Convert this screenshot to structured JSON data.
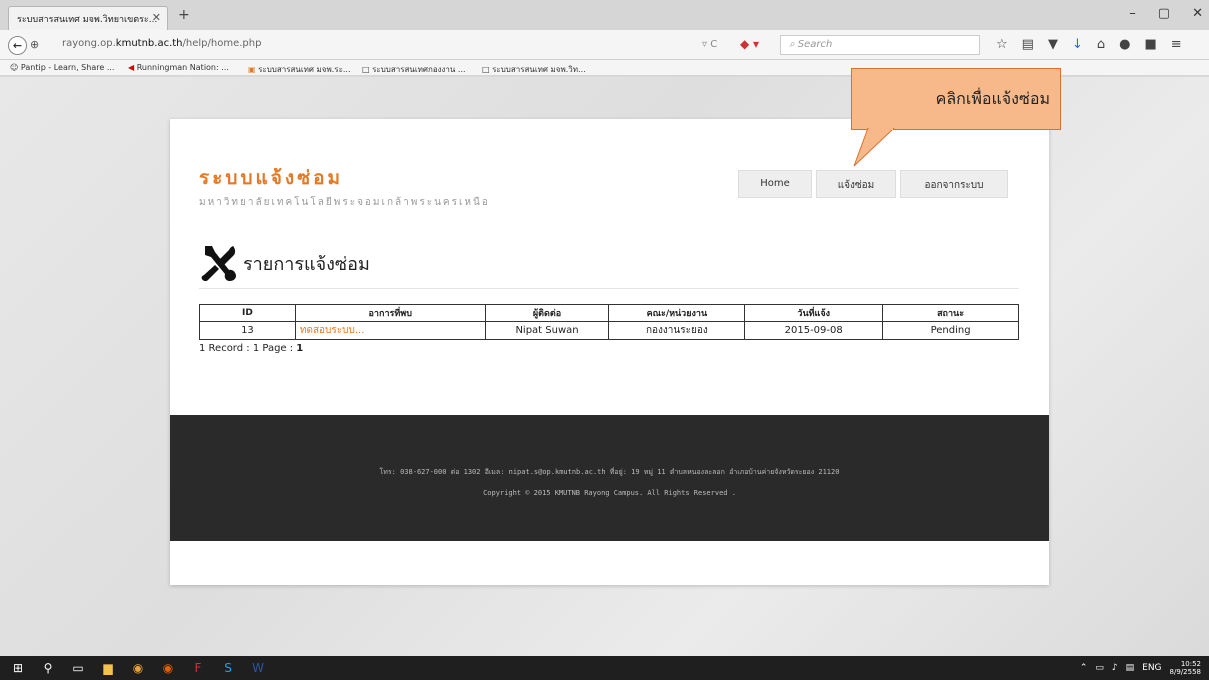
{
  "browser": {
    "tab_title": "ระบบสารสนเทศ มจพ.วิทยาเขตระ...",
    "tab_close": "✕",
    "new_tab": "+",
    "window_controls": [
      "–",
      "▢",
      "✕"
    ],
    "url_prefix": "rayong.op.",
    "url_domain": "kmutnb.ac.th",
    "url_path": "/help/home.php",
    "url_right": "▿ C",
    "search_placeholder": "Search",
    "bookmarks": [
      "Pantip - Learn, Share ...",
      "Runningman Nation: ...",
      "ระบบสารสนเทศ มจพ.ระ...",
      "ระบบสารสนเทศกองงาน ...",
      "ระบบสารสนเทศ มจพ.วิท..."
    ]
  },
  "site": {
    "title": "ระบบแจ้งซ่อม",
    "subtitle": "มหาวิทยาลัยเทคโนโลยีพระจอมเกล้าพระนครเหนือ",
    "nav": [
      "Home",
      "แจ้งซ่อม",
      "ออกจากระบบ"
    ]
  },
  "page": {
    "heading": "รายการแจ้งซ่อม"
  },
  "table": {
    "headers": [
      "ID",
      "อาการที่พบ",
      "ผู้ติดต่อ",
      "คณะ/หน่วยงาน",
      "วันที่แจ้ง",
      "สถานะ"
    ],
    "rows": [
      [
        "13",
        "ทดสอบระบบ...",
        "Nipat  Suwan",
        "กองงานระยอง",
        "2015-09-08",
        "Pending"
      ]
    ]
  },
  "pagination": {
    "label": "1 Record : 1 Page : ",
    "current": "1"
  },
  "footer": {
    "contact": "โทร: 038-627-000 ต่อ 1302 อีเมล: nipat.s@op.kmutnb.ac.th ที่อยู่: 19 หมู่ 11 ตำบลหนองละลอก อำเภอบ้านค่ายจังหวัดระยอง 21120",
    "copyright": "Copyright © 2015 KMUTNB Rayong Campus. All Rights Reserved ."
  },
  "annotation": {
    "callout_text": "คลิกเพื่อแจ้งซ่อม"
  },
  "taskbar": {
    "lang": "ENG",
    "time": "10:52",
    "date": "8/9/2558"
  },
  "colors": {
    "accent": "#e57a25",
    "callout_fill": "#f8b98a",
    "footer_bg": "#2a2a2a"
  }
}
